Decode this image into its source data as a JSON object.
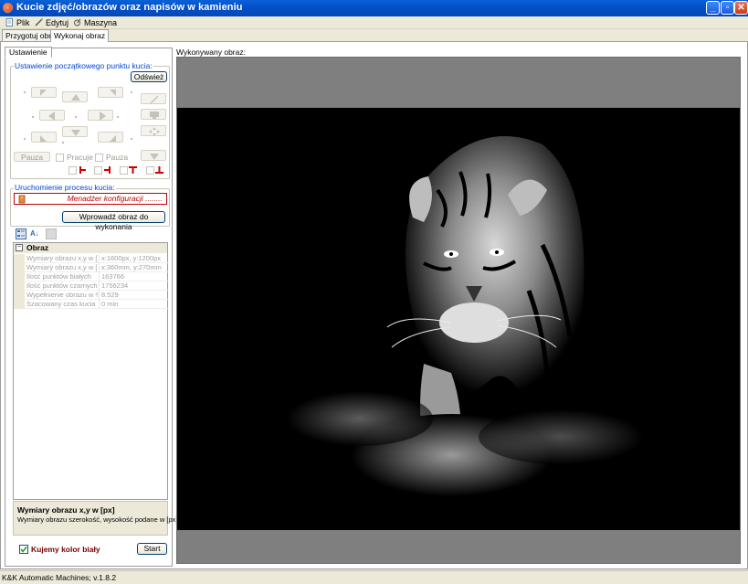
{
  "window": {
    "title": "Kucie zdjęć/obrazów oraz napisów w kamieniu"
  },
  "menu": [
    {
      "label": "Plik",
      "icon": "file-icon"
    },
    {
      "label": "Edytuj",
      "icon": "edit-icon"
    },
    {
      "label": "Maszyna",
      "icon": "machine-icon"
    }
  ],
  "outer_tabs": [
    {
      "label": "Przygotuj obraz",
      "active": false
    },
    {
      "label": "Wykonaj obraz",
      "active": true
    }
  ],
  "inner_tab": {
    "label": "Ustawienie"
  },
  "start_point_group": {
    "title": "Ustawienie początkowego punktu kucia:",
    "refresh_button": "Odśwież",
    "pause_button": "Pauza",
    "working_label": "Pracuje",
    "pause_label": "Pauza"
  },
  "process_group": {
    "title": "Uruchomienie procesu kucia:",
    "config_manager": "Menadżer konfiguracji ........",
    "load_button": "Wprowadź obraz do wykonania"
  },
  "properties": {
    "category": "Obraz",
    "rows": [
      {
        "name": "Wymiary obrazu x,y w [px]",
        "value": "x:1600px, y:1200px"
      },
      {
        "name": "Wymiary obrazu x,y w [mm]",
        "value": "x:360mm, y:270mm"
      },
      {
        "name": "Ilość punktów białych",
        "value": "163766"
      },
      {
        "name": "Ilość punktów czarnych",
        "value": "1756234"
      },
      {
        "name": "Wypełnienie obrazu w %",
        "value": "8.529"
      },
      {
        "name": "Szacowany czas kucia",
        "value": "0 min"
      }
    ],
    "help_title": "Wymiary obrazu x,y w [px]",
    "help_text": "Wymiary obrazu szerokość, wysokość podane w [px]"
  },
  "bottom": {
    "checkbox_label": "Kujemy kolor biały",
    "checkbox_checked": true,
    "start_button": "Start"
  },
  "image_panel": {
    "label": "Wykonywany obraz:"
  },
  "status": {
    "text": "K&K Automatic Machines; v.1.8.2"
  },
  "colors": {
    "titlebar": "#0550c8",
    "group_label": "#0046d5",
    "checkbox_label": "#7a0000",
    "image_bg": "#000000",
    "image_frame": "#7f7f7f"
  }
}
